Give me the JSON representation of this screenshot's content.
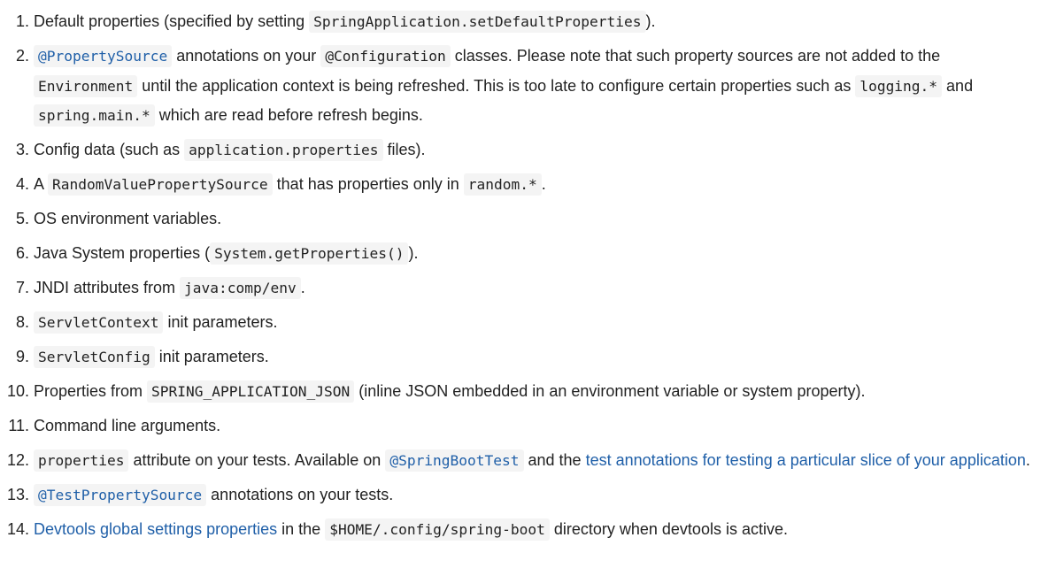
{
  "colors": {
    "text": "#222222",
    "link": "#1f5fa8",
    "code_background": "#f4f4f4",
    "page_background": "#ffffff"
  },
  "items": [
    {
      "number": "1.",
      "segments": [
        {
          "type": "text",
          "text": "Default properties (specified by setting "
        },
        {
          "type": "code",
          "text": "SpringApplication.setDefaultProperties"
        },
        {
          "type": "text",
          "text": ")."
        }
      ]
    },
    {
      "number": "2.",
      "segments": [
        {
          "type": "code-link",
          "text": "@PropertySource"
        },
        {
          "type": "text",
          "text": " annotations on your "
        },
        {
          "type": "code",
          "text": "@Configuration"
        },
        {
          "type": "text",
          "text": " classes. Please note that such property sources are not added to the "
        },
        {
          "type": "code",
          "text": "Environment"
        },
        {
          "type": "text",
          "text": " until the application context is being refreshed. This is too late to configure certain properties such as "
        },
        {
          "type": "code",
          "text": "logging.*"
        },
        {
          "type": "text",
          "text": " and "
        },
        {
          "type": "code",
          "text": "spring.main.*"
        },
        {
          "type": "text",
          "text": " which are read before refresh begins."
        }
      ]
    },
    {
      "number": "3.",
      "segments": [
        {
          "type": "text",
          "text": "Config data (such as "
        },
        {
          "type": "code",
          "text": "application.properties"
        },
        {
          "type": "text",
          "text": " files)."
        }
      ]
    },
    {
      "number": "4.",
      "segments": [
        {
          "type": "text",
          "text": "A "
        },
        {
          "type": "code",
          "text": "RandomValuePropertySource"
        },
        {
          "type": "text",
          "text": " that has properties only in "
        },
        {
          "type": "code",
          "text": "random.*"
        },
        {
          "type": "text",
          "text": "."
        }
      ]
    },
    {
      "number": "5.",
      "segments": [
        {
          "type": "text",
          "text": "OS environment variables."
        }
      ]
    },
    {
      "number": "6.",
      "segments": [
        {
          "type": "text",
          "text": "Java System properties ("
        },
        {
          "type": "code",
          "text": "System.getProperties()"
        },
        {
          "type": "text",
          "text": ")."
        }
      ]
    },
    {
      "number": "7.",
      "segments": [
        {
          "type": "text",
          "text": "JNDI attributes from "
        },
        {
          "type": "code",
          "text": "java:comp/env"
        },
        {
          "type": "text",
          "text": "."
        }
      ]
    },
    {
      "number": "8.",
      "segments": [
        {
          "type": "code",
          "text": "ServletContext"
        },
        {
          "type": "text",
          "text": " init parameters."
        }
      ]
    },
    {
      "number": "9.",
      "segments": [
        {
          "type": "code",
          "text": "ServletConfig"
        },
        {
          "type": "text",
          "text": " init parameters."
        }
      ]
    },
    {
      "number": "10.",
      "segments": [
        {
          "type": "text",
          "text": "Properties from "
        },
        {
          "type": "code",
          "text": "SPRING_APPLICATION_JSON"
        },
        {
          "type": "text",
          "text": " (inline JSON embedded in an environment variable or system property)."
        }
      ]
    },
    {
      "number": "11.",
      "segments": [
        {
          "type": "text",
          "text": "Command line arguments."
        }
      ]
    },
    {
      "number": "12.",
      "segments": [
        {
          "type": "code",
          "text": "properties"
        },
        {
          "type": "text",
          "text": " attribute on your tests. Available on "
        },
        {
          "type": "code-link",
          "text": "@SpringBootTest"
        },
        {
          "type": "text",
          "text": " and the "
        },
        {
          "type": "link",
          "text": "test annotations for testing a particular slice of your application"
        },
        {
          "type": "text",
          "text": "."
        }
      ]
    },
    {
      "number": "13.",
      "segments": [
        {
          "type": "code-link",
          "text": "@TestPropertySource"
        },
        {
          "type": "text",
          "text": " annotations on your tests."
        }
      ]
    },
    {
      "number": "14.",
      "segments": [
        {
          "type": "link",
          "text": "Devtools global settings properties"
        },
        {
          "type": "text",
          "text": " in the "
        },
        {
          "type": "code",
          "text": "$HOME/.config/spring-boot"
        },
        {
          "type": "text",
          "text": " directory when devtools is active."
        }
      ]
    }
  ]
}
